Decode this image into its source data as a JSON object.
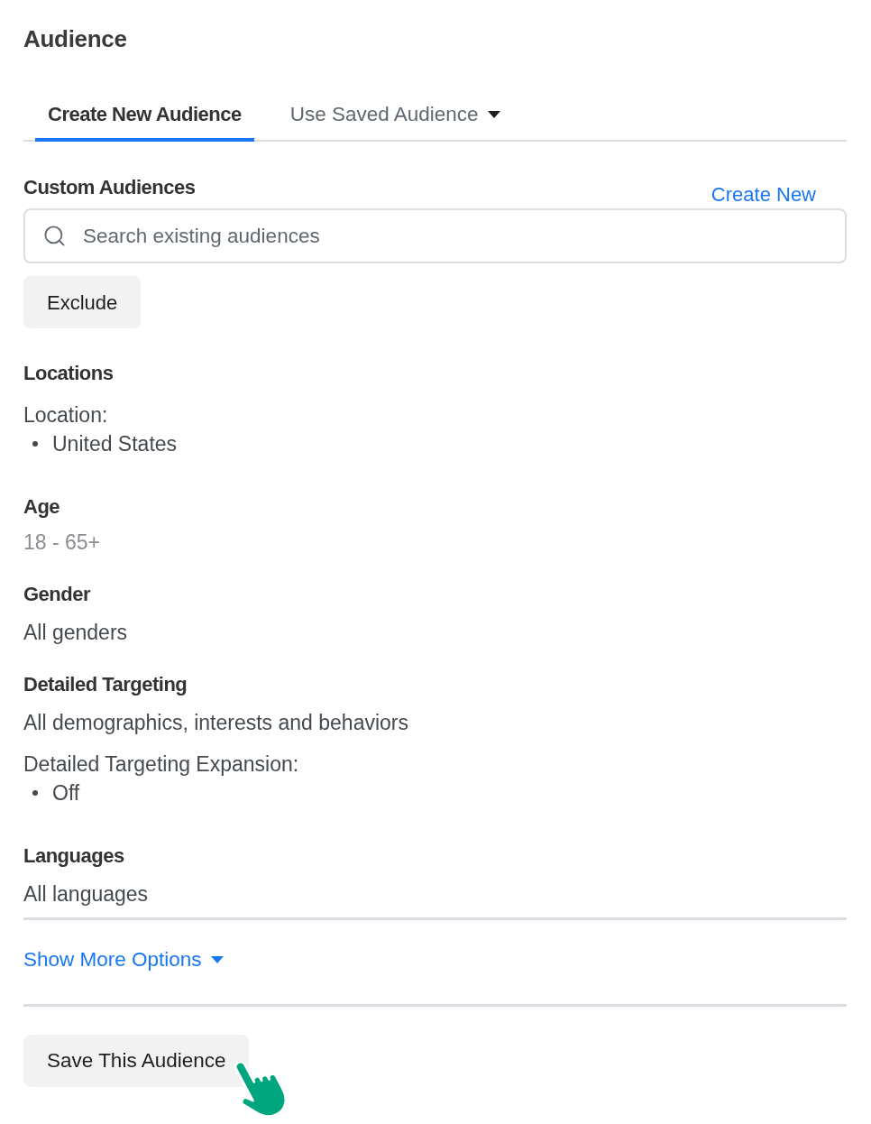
{
  "title": "Audience",
  "tabs": [
    {
      "label": "Create New Audience",
      "selected": true,
      "dropdown": false
    },
    {
      "label": "Use Saved Audience",
      "selected": false,
      "dropdown": true
    }
  ],
  "custom_audiences": {
    "heading": "Custom Audiences",
    "create_link": "Create New",
    "search": {
      "placeholder": "Search existing audiences"
    },
    "exclude_button": "Exclude"
  },
  "sections": [
    {
      "heading": "Locations",
      "items": [
        {
          "kind": "label",
          "text": "Location:"
        },
        {
          "kind": "bullet",
          "text": "United States"
        }
      ]
    },
    {
      "heading": "Age",
      "items": [
        {
          "kind": "muted",
          "text": "18 - 65+"
        }
      ]
    },
    {
      "heading": "Gender",
      "items": [
        {
          "kind": "plain",
          "text": "All genders"
        }
      ]
    },
    {
      "heading": "Detailed Targeting",
      "items": [
        {
          "kind": "plain",
          "text": "All demographics, interests and behaviors"
        },
        {
          "kind": "label",
          "text": "Detailed Targeting Expansion:"
        },
        {
          "kind": "bullet",
          "text": "Off"
        }
      ]
    },
    {
      "heading": "Languages",
      "items": [
        {
          "kind": "plain",
          "text": "All languages"
        }
      ]
    }
  ],
  "show_more": "Show More Options",
  "save_button": "Save This Audience"
}
